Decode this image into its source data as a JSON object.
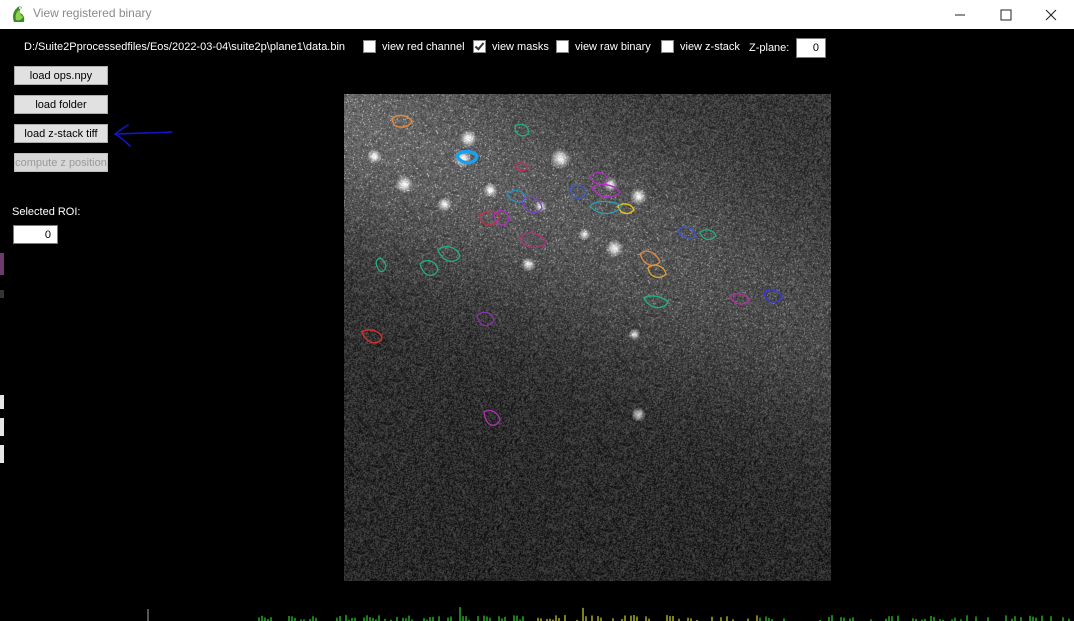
{
  "window": {
    "title": "View registered binary",
    "app_icon": "frog-icon",
    "controls": {
      "minimize": "minimize-icon",
      "maximize": "maximize-icon",
      "close": "close-icon"
    }
  },
  "toolbar": {
    "file_path": "D:/Suite2Pprocessedfiles/Eos/2022-03-04\\suite2p\\plane1\\data.bin",
    "checkboxes": [
      {
        "label": "view red channel",
        "checked": false
      },
      {
        "label": "view masks",
        "checked": true
      },
      {
        "label": "view raw binary",
        "checked": false
      },
      {
        "label": "view z-stack",
        "checked": false
      }
    ],
    "zplane_label": "Z-plane:",
    "zplane_value": "0"
  },
  "sidebar": {
    "buttons": [
      {
        "label": "load ops.npy",
        "enabled": true
      },
      {
        "label": "load folder",
        "enabled": true
      },
      {
        "label": "load z-stack tiff",
        "enabled": true
      },
      {
        "label": "compute z position",
        "enabled": false
      }
    ],
    "selected_roi_label": "Selected ROI:",
    "selected_roi_value": "0"
  },
  "annotation": {
    "icon": "arrow-left-icon",
    "color": "#1414c8"
  },
  "colors": {
    "background": "#000000",
    "titlebar": "#ffffff",
    "trace_green": "#33ff33",
    "trace_yellow": "#ffff33"
  }
}
